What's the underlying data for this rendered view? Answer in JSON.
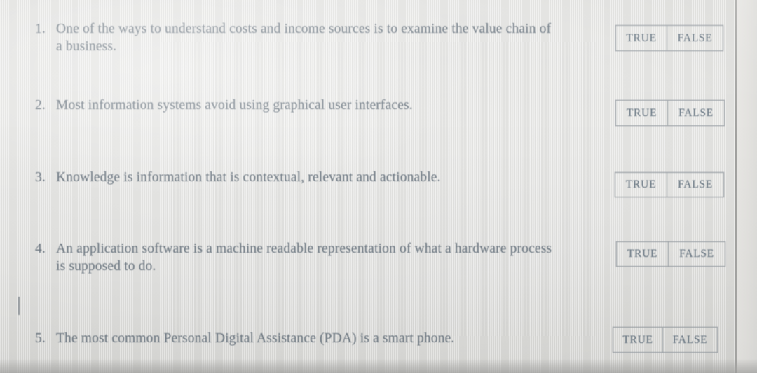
{
  "document": {
    "type": "true-false-quiz",
    "background_color": "#e3e3e1",
    "text_color": "#6f7a84",
    "box_border_color": "#9aa0a6",
    "page_edge_color": "#a1a1a0"
  },
  "answer_options": {
    "true_label": "TRUE",
    "false_label": "FALSE"
  },
  "questions": [
    {
      "number": "1.",
      "text": "One of the ways to understand costs and income sources is to examine the value chain of a business.",
      "true_label": "TRUE",
      "false_label": "FALSE"
    },
    {
      "number": "2.",
      "text": "Most information systems avoid using graphical user interfaces.",
      "true_label": "TRUE",
      "false_label": "FALSE"
    },
    {
      "number": "3.",
      "text": "Knowledge is information that is contextual, relevant and actionable.",
      "true_label": "TRUE",
      "false_label": "FALSE"
    },
    {
      "number": "4.",
      "text": "An application software is a machine readable representation of what a hardware process is supposed to do.",
      "true_label": "TRUE",
      "false_label": "FALSE"
    },
    {
      "number": "5.",
      "text": "The most common Personal Digital Assistance (PDA) is a smart phone.",
      "true_label": "TRUE",
      "false_label": "FALSE"
    }
  ]
}
